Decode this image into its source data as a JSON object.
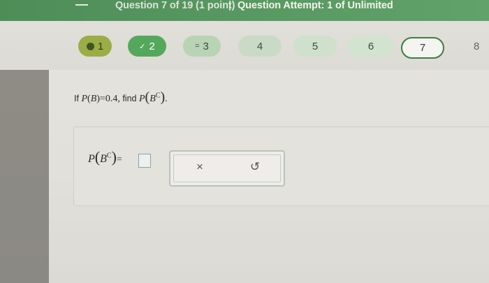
{
  "header": {
    "question_progress": "Question 7 of 19 (1 point)",
    "separator": "|",
    "attempt": "Question Attempt: 1 of Unlimited"
  },
  "nav": {
    "questions": [
      {
        "label": "1",
        "status": "partial",
        "icon": "partial-dot-icon"
      },
      {
        "label": "2",
        "status": "correct",
        "icon": "check-icon",
        "icon_glyph": "✓"
      },
      {
        "label": "3",
        "status": "answered",
        "icon": "equals-icon",
        "icon_glyph": "="
      },
      {
        "label": "4",
        "status": "unanswered"
      },
      {
        "label": "5",
        "status": "unanswered"
      },
      {
        "label": "6",
        "status": "unanswered"
      },
      {
        "label": "7",
        "status": "current"
      },
      {
        "label": "8",
        "status": "unanswered"
      }
    ]
  },
  "question": {
    "prefix": "If",
    "p": "P",
    "b": "B",
    "given_value": "=0.4,",
    "find": "find",
    "complement_sup": "C",
    "end": "."
  },
  "answer": {
    "p": "P",
    "b": "B",
    "complement_sup": "C",
    "equals": "=",
    "value": ""
  },
  "controls": {
    "clear_glyph": "×",
    "clear_icon": "clear-x-icon",
    "undo_glyph": "↺",
    "undo_icon": "undo-icon"
  },
  "colors": {
    "header_bg": "#5a9a62",
    "correct": "#54a85c",
    "partial": "#9aad46",
    "current_border": "#3d7d45"
  }
}
